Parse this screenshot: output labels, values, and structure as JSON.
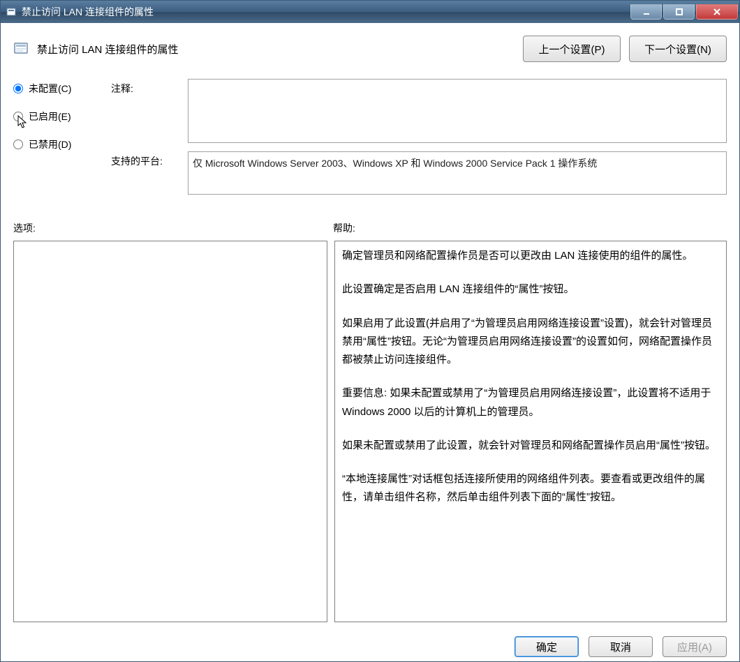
{
  "window": {
    "title": "禁止访问 LAN 连接组件的属性"
  },
  "header": {
    "title": "禁止访问 LAN 连接组件的属性",
    "prev_button": "上一个设置(P)",
    "next_button": "下一个设置(N)"
  },
  "radios": {
    "not_configured": "未配置(C)",
    "enabled": "已启用(E)",
    "disabled": "已禁用(D)",
    "selected": "not_configured"
  },
  "comment_label": "注释:",
  "comment_value": "",
  "platform_label": "支持的平台:",
  "platform_value": "仅 Microsoft Windows Server 2003、Windows XP 和 Windows 2000 Service Pack 1 操作系统",
  "options_label": "选项:",
  "help_label": "帮助:",
  "help_paragraphs": [
    "确定管理员和网络配置操作员是否可以更改由 LAN 连接使用的组件的属性。",
    "此设置确定是否启用 LAN 连接组件的“属性”按钮。",
    "如果启用了此设置(并启用了“为管理员启用网络连接设置”设置)，就会针对管理员禁用“属性”按钮。无论“为管理员启用网络连接设置”的设置如何，网络配置操作员都被禁止访问连接组件。",
    "重要信息: 如果未配置或禁用了“为管理员启用网络连接设置”，此设置将不适用于 Windows 2000 以后的计算机上的管理员。",
    "如果未配置或禁用了此设置，就会针对管理员和网络配置操作员启用“属性”按钮。",
    "“本地连接属性”对话框包括连接所使用的网络组件列表。要查看或更改组件的属性，请单击组件名称，然后单击组件列表下面的“属性”按钮。"
  ],
  "buttons": {
    "ok": "确定",
    "cancel": "取消",
    "apply": "应用(A)"
  }
}
